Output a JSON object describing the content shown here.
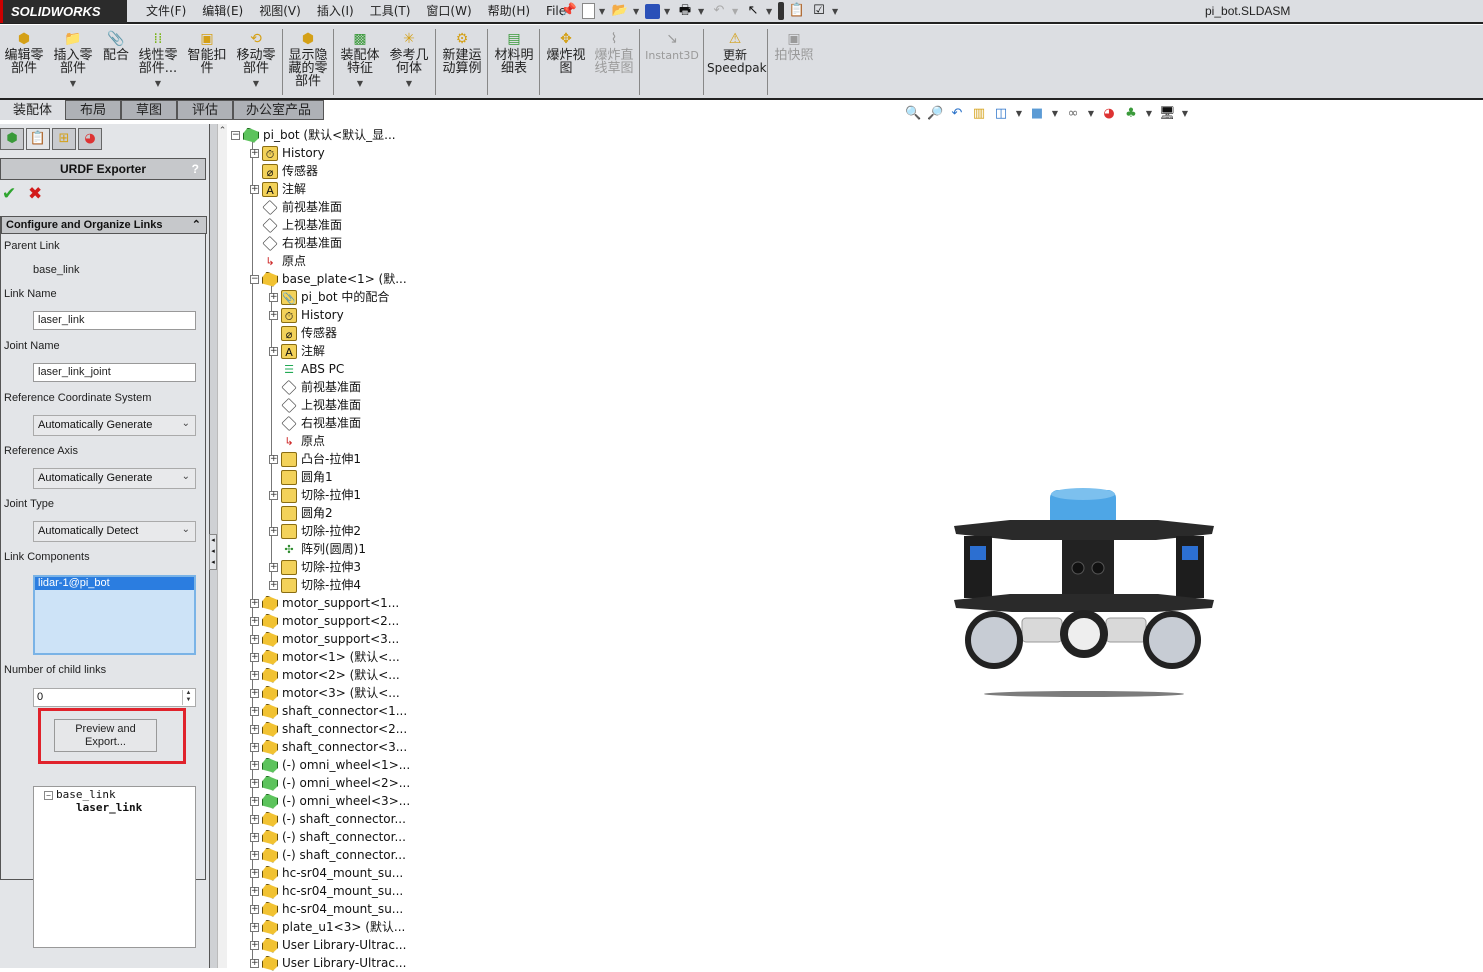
{
  "app": {
    "logo": "SOLIDWORKS",
    "document_title": "pi_bot.SLDASM"
  },
  "menu": [
    "文件(F)",
    "编辑(E)",
    "视图(V)",
    "插入(I)",
    "工具(T)",
    "窗口(W)",
    "帮助(H)",
    "File"
  ],
  "quick_access": [
    {
      "icon": "pin-icon"
    },
    {
      "icon": "new-document-icon",
      "dropdown": true
    },
    {
      "icon": "open-folder-icon",
      "dropdown": true
    },
    {
      "icon": "save-icon",
      "dropdown": true
    },
    {
      "icon": "print-icon",
      "dropdown": true
    },
    {
      "icon": "undo-icon",
      "dropdown": true
    },
    {
      "icon": "select-pointer-icon",
      "dropdown": true
    },
    {
      "icon": "rebuild-traffic-light-icon"
    },
    {
      "icon": "file-properties-icon"
    },
    {
      "icon": "options-icon",
      "dropdown": true
    }
  ],
  "ribbon": [
    {
      "label": "编辑零\n部件",
      "icon": "edit-component-icon",
      "enabled": true,
      "dropdown": false
    },
    {
      "label": "插入零\n部件",
      "icon": "insert-component-icon",
      "enabled": true,
      "dropdown": true
    },
    {
      "label": "配合",
      "icon": "mate-icon",
      "enabled": true,
      "dropdown": false
    },
    {
      "label": "线性零\n部件...",
      "icon": "linear-pattern-icon",
      "enabled": true,
      "dropdown": true
    },
    {
      "label": "智能扣\n件",
      "icon": "smart-fasteners-icon",
      "enabled": true,
      "dropdown": false
    },
    {
      "label": "移动零\n部件",
      "icon": "move-component-icon",
      "enabled": true,
      "dropdown": true
    },
    {
      "label": "显示隐\n藏的零\n部件",
      "icon": "show-hidden-icon",
      "enabled": true,
      "dropdown": false
    },
    {
      "label": "装配体\n特征",
      "icon": "assembly-features-icon",
      "enabled": true,
      "dropdown": true
    },
    {
      "label": "参考几\n何体",
      "icon": "reference-geometry-icon",
      "enabled": true,
      "dropdown": true
    },
    {
      "label": "新建运\n动算例",
      "icon": "new-motion-study-icon",
      "enabled": true,
      "dropdown": false
    },
    {
      "label": "材料明\n细表",
      "icon": "bill-of-materials-icon",
      "enabled": true,
      "dropdown": false
    },
    {
      "label": "爆炸视\n图",
      "icon": "exploded-view-icon",
      "enabled": true,
      "dropdown": false
    },
    {
      "label": "爆炸直\n线草图",
      "icon": "explode-line-sketch-icon",
      "enabled": false,
      "dropdown": false
    },
    {
      "label": "Instant3D",
      "icon": "instant3d-icon",
      "enabled": false,
      "dropdown": false
    },
    {
      "label": "更新\nSpeedpak",
      "icon": "update-speedpak-icon",
      "enabled": true,
      "dropdown": false
    },
    {
      "label": "拍快照",
      "icon": "snapshot-icon",
      "enabled": false,
      "dropdown": false
    }
  ],
  "tabs": [
    {
      "label": "装配体",
      "active": true
    },
    {
      "label": "布局",
      "active": false
    },
    {
      "label": "草图",
      "active": false
    },
    {
      "label": "评估",
      "active": false
    },
    {
      "label": "办公室产品",
      "active": false
    }
  ],
  "heads_up_toolbar": [
    "zoom-to-fit-icon",
    "zoom-to-area-icon",
    "previous-view-icon",
    "section-view-icon",
    "view-orientation-icon",
    "display-style-icon",
    "hide-show-items-icon",
    "edit-appearance-icon",
    "apply-scene-icon",
    "view-settings-icon"
  ],
  "panel_tabs": [
    "feature-manager-icon",
    "property-manager-icon",
    "configuration-manager-icon",
    "appearance-manager-icon"
  ],
  "property_manager": {
    "title": "URDF Exporter",
    "help": "?",
    "group_title": "Configure and Organize Links",
    "parent_link_label": "Parent Link",
    "parent_link_value": "base_link",
    "link_name_label": "Link Name",
    "link_name_value": "laser_link",
    "joint_name_label": "Joint Name",
    "joint_name_value": "laser_link_joint",
    "ref_coord_label": "Reference Coordinate System",
    "ref_coord_value": "Automatically Generate",
    "ref_axis_label": "Reference Axis",
    "ref_axis_value": "Automatically Generate",
    "joint_type_label": "Joint Type",
    "joint_type_value": "Automatically Detect",
    "link_components_label": "Link Components",
    "link_components": [
      "lidar-1@pi_bot"
    ],
    "child_links_label": "Number of child links",
    "child_links_value": "0",
    "preview_button": "Preview and\nExport...",
    "link_tree": {
      "root": "base_link",
      "child": "laser_link"
    }
  },
  "feature_tree": [
    {
      "label": "pi_bot  (默认<默认_显...",
      "icon": "assembly",
      "level": 0,
      "exp": "-"
    },
    {
      "label": "History",
      "icon": "history",
      "level": 1,
      "exp": "+"
    },
    {
      "label": "传感器",
      "icon": "sensor",
      "level": 1,
      "exp": ""
    },
    {
      "label": "注解",
      "icon": "annotation",
      "level": 1,
      "exp": "+"
    },
    {
      "label": "前视基准面",
      "icon": "plane",
      "level": 1,
      "exp": ""
    },
    {
      "label": "上视基准面",
      "icon": "plane",
      "level": 1,
      "exp": ""
    },
    {
      "label": "右视基准面",
      "icon": "plane",
      "level": 1,
      "exp": ""
    },
    {
      "label": "原点",
      "icon": "origin",
      "level": 1,
      "exp": ""
    },
    {
      "label": "base_plate<1> (默...",
      "icon": "part",
      "level": 1,
      "exp": "-"
    },
    {
      "label": "pi_bot 中的配合",
      "icon": "mates",
      "level": 2,
      "exp": "+"
    },
    {
      "label": "History",
      "icon": "history",
      "level": 2,
      "exp": "+"
    },
    {
      "label": "传感器",
      "icon": "sensor",
      "level": 2,
      "exp": ""
    },
    {
      "label": "注解",
      "icon": "annotation",
      "level": 2,
      "exp": "+"
    },
    {
      "label": "ABS PC",
      "icon": "material",
      "level": 2,
      "exp": ""
    },
    {
      "label": "前视基准面",
      "icon": "plane",
      "level": 2,
      "exp": ""
    },
    {
      "label": "上视基准面",
      "icon": "plane",
      "level": 2,
      "exp": ""
    },
    {
      "label": "右视基准面",
      "icon": "plane",
      "level": 2,
      "exp": ""
    },
    {
      "label": "原点",
      "icon": "origin",
      "level": 2,
      "exp": ""
    },
    {
      "label": "凸台-拉伸1",
      "icon": "boss",
      "level": 2,
      "exp": "+"
    },
    {
      "label": "圆角1",
      "icon": "fillet",
      "level": 2,
      "exp": ""
    },
    {
      "label": "切除-拉伸1",
      "icon": "cut",
      "level": 2,
      "exp": "+"
    },
    {
      "label": "圆角2",
      "icon": "fillet",
      "level": 2,
      "exp": ""
    },
    {
      "label": "切除-拉伸2",
      "icon": "cut",
      "level": 2,
      "exp": "+"
    },
    {
      "label": "阵列(圆周)1",
      "icon": "pattern",
      "level": 2,
      "exp": ""
    },
    {
      "label": "切除-拉伸3",
      "icon": "cut",
      "level": 2,
      "exp": "+"
    },
    {
      "label": "切除-拉伸4",
      "icon": "cut",
      "level": 2,
      "exp": "+"
    },
    {
      "label": "motor_support<1...",
      "icon": "part",
      "level": 1,
      "exp": "+"
    },
    {
      "label": "motor_support<2...",
      "icon": "part",
      "level": 1,
      "exp": "+"
    },
    {
      "label": "motor_support<3...",
      "icon": "part",
      "level": 1,
      "exp": "+"
    },
    {
      "label": "motor<1> (默认<...",
      "icon": "part",
      "level": 1,
      "exp": "+"
    },
    {
      "label": "motor<2> (默认<...",
      "icon": "part",
      "level": 1,
      "exp": "+"
    },
    {
      "label": "motor<3> (默认<...",
      "icon": "part",
      "level": 1,
      "exp": "+"
    },
    {
      "label": "shaft_connector<1...",
      "icon": "part",
      "level": 1,
      "exp": "+"
    },
    {
      "label": "shaft_connector<2...",
      "icon": "part",
      "level": 1,
      "exp": "+"
    },
    {
      "label": "shaft_connector<3...",
      "icon": "part",
      "level": 1,
      "exp": "+"
    },
    {
      "label": "(-) omni_wheel<1>...",
      "icon": "subassembly",
      "level": 1,
      "exp": "+"
    },
    {
      "label": "(-) omni_wheel<2>...",
      "icon": "subassembly",
      "level": 1,
      "exp": "+"
    },
    {
      "label": "(-) omni_wheel<3>...",
      "icon": "subassembly",
      "level": 1,
      "exp": "+"
    },
    {
      "label": "(-) shaft_connector...",
      "icon": "part",
      "level": 1,
      "exp": "+"
    },
    {
      "label": "(-) shaft_connector...",
      "icon": "part",
      "level": 1,
      "exp": "+"
    },
    {
      "label": "(-) shaft_connector...",
      "icon": "part",
      "level": 1,
      "exp": "+"
    },
    {
      "label": "hc-sr04_mount_su...",
      "icon": "part",
      "level": 1,
      "exp": "+"
    },
    {
      "label": "hc-sr04_mount_su...",
      "icon": "part",
      "level": 1,
      "exp": "+"
    },
    {
      "label": "hc-sr04_mount_su...",
      "icon": "part",
      "level": 1,
      "exp": "+"
    },
    {
      "label": "plate_u1<3> (默认...",
      "icon": "part",
      "level": 1,
      "exp": "+"
    },
    {
      "label": "User Library-Ultrac...",
      "icon": "part",
      "level": 1,
      "exp": "+"
    },
    {
      "label": "User Library-Ultrac...",
      "icon": "part",
      "level": 1,
      "exp": "+"
    }
  ],
  "viewport": {
    "model": "pi_bot omni-wheel robot with lidar"
  },
  "colors": {
    "accent_blue": "#2b7de0",
    "highlight_red": "#e0222b",
    "ok_green": "#2fa52f",
    "lidar_blue": "#4ea6e6"
  }
}
